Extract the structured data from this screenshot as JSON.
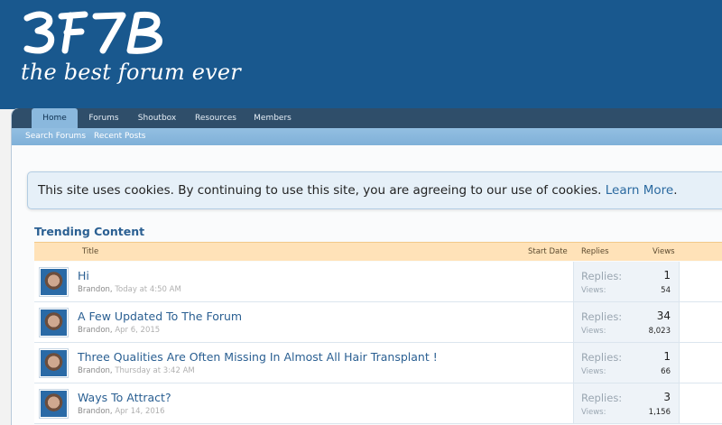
{
  "header": {
    "logo_text": "3F7B",
    "tagline": "the best forum ever"
  },
  "nav": {
    "tabs": [
      {
        "label": "Home",
        "active": true
      },
      {
        "label": "Forums",
        "active": false
      },
      {
        "label": "Shoutbox",
        "active": false
      },
      {
        "label": "Resources",
        "active": false
      },
      {
        "label": "Members",
        "active": false
      }
    ],
    "sublinks": [
      "Search Forums",
      "Recent Posts"
    ]
  },
  "notice": {
    "text": "This site uses cookies. By continuing to use this site, you are agreeing to our use of cookies. ",
    "link": "Learn More",
    "end": "."
  },
  "trending": {
    "title": "Trending Content",
    "columns": {
      "title": "Title",
      "start_date": "Start Date",
      "replies": "Replies",
      "views": "Views"
    },
    "stat_labels": {
      "replies": "Replies:",
      "views": "Views:"
    },
    "rows": [
      {
        "title": "Hi",
        "author": "Brandon",
        "date": "Today at 4:50 AM",
        "replies": "1",
        "views": "54"
      },
      {
        "title": "A Few Updated To The Forum",
        "author": "Brandon",
        "date": "Apr 6, 2015",
        "replies": "34",
        "views": "8,023"
      },
      {
        "title": "Three Qualities Are Often Missing In Almost All Hair Transplant !",
        "author": "Brandon",
        "date": "Thursday at 3:42 AM",
        "replies": "1",
        "views": "66"
      },
      {
        "title": "Ways To Attract?",
        "author": "Brandon",
        "date": "Apr 14, 2016",
        "replies": "3",
        "views": "1,156"
      }
    ]
  },
  "colors": {
    "header_bg": "#19588e",
    "tab_bar": "#2f4e6a",
    "subnav": "#8ab8dd",
    "table_head": "#ffe2b8",
    "link": "#2a5f92"
  }
}
